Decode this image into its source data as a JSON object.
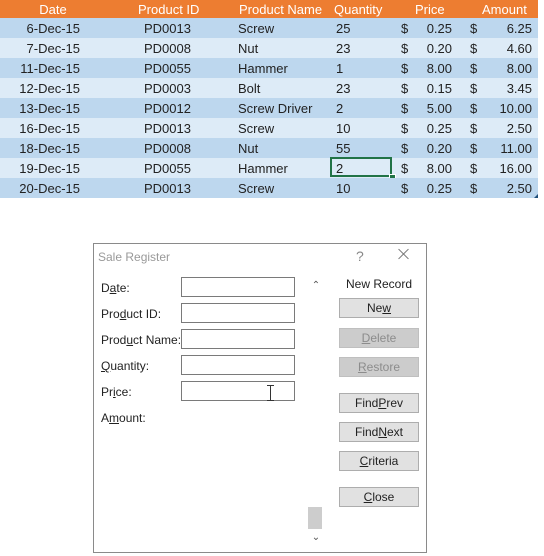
{
  "sheet": {
    "headers": {
      "date": "Date",
      "product_id": "Product ID",
      "product_name": "Product Name",
      "quantity": "Quantity",
      "price": "Price",
      "amount": "Amount"
    },
    "rows": [
      {
        "date": "6-Dec-15",
        "pid": "PD0013",
        "name": "Screw",
        "qty": "25",
        "cur": "$",
        "price": "0.25",
        "amt": "6.25"
      },
      {
        "date": "7-Dec-15",
        "pid": "PD0008",
        "name": "Nut",
        "qty": "23",
        "cur": "$",
        "price": "0.20",
        "amt": "4.60"
      },
      {
        "date": "11-Dec-15",
        "pid": "PD0055",
        "name": "Hammer",
        "qty": "1",
        "cur": "$",
        "price": "8.00",
        "amt": "8.00"
      },
      {
        "date": "12-Dec-15",
        "pid": "PD0003",
        "name": "Bolt",
        "qty": "23",
        "cur": "$",
        "price": "0.15",
        "amt": "3.45"
      },
      {
        "date": "13-Dec-15",
        "pid": "PD0012",
        "name": "Screw Driver",
        "qty": "2",
        "cur": "$",
        "price": "5.00",
        "amt": "10.00"
      },
      {
        "date": "16-Dec-15",
        "pid": "PD0013",
        "name": "Screw",
        "qty": "10",
        "cur": "$",
        "price": "0.25",
        "amt": "2.50"
      },
      {
        "date": "18-Dec-15",
        "pid": "PD0008",
        "name": "Nut",
        "qty": "55",
        "cur": "$",
        "price": "0.20",
        "amt": "11.00"
      },
      {
        "date": "19-Dec-15",
        "pid": "PD0055",
        "name": "Hammer",
        "qty": "2",
        "cur": "$",
        "price": "8.00",
        "amt": "16.00"
      },
      {
        "date": "20-Dec-15",
        "pid": "PD0013",
        "name": "Screw",
        "qty": "10",
        "cur": "$",
        "price": "0.25",
        "amt": "2.50"
      }
    ],
    "colors": {
      "header_bg": "#ed7d31",
      "row_dark": "#bdd7ee",
      "row_light": "#ddebf7",
      "selection": "#217346"
    }
  },
  "dialog": {
    "title": "Sale Register",
    "help_label": "?",
    "fields": {
      "date": {
        "prefix": "D",
        "access": "a",
        "suffix": "te:",
        "value": ""
      },
      "product_id": {
        "prefix": "Pro",
        "access": "d",
        "suffix": "uct ID:",
        "value": ""
      },
      "product_name": {
        "prefix": "Prod",
        "access": "u",
        "suffix": "ct Name:",
        "value": ""
      },
      "quantity": {
        "prefix": "",
        "access": "Q",
        "suffix": "uantity:",
        "value": ""
      },
      "price": {
        "prefix": "Pr",
        "access": "i",
        "suffix": "ce:",
        "value": ""
      },
      "amount": {
        "prefix": "A",
        "access": "m",
        "suffix": "ount:"
      }
    },
    "record_label": "New Record",
    "buttons": {
      "new": {
        "prefix": "Ne",
        "access": "w",
        "suffix": ""
      },
      "delete": {
        "prefix": "",
        "access": "D",
        "suffix": "elete"
      },
      "restore": {
        "prefix": "",
        "access": "R",
        "suffix": "estore"
      },
      "find_prev": {
        "prefix": "Find ",
        "access": "P",
        "suffix": "rev"
      },
      "find_next": {
        "prefix": "Find ",
        "access": "N",
        "suffix": "ext"
      },
      "criteria": {
        "prefix": "",
        "access": "C",
        "suffix": "riteria"
      },
      "close": {
        "prefix": "",
        "access": "C",
        "suffix": "lose"
      }
    },
    "scroll_up_glyph": "⌃",
    "scroll_down_glyph": "⌄"
  }
}
